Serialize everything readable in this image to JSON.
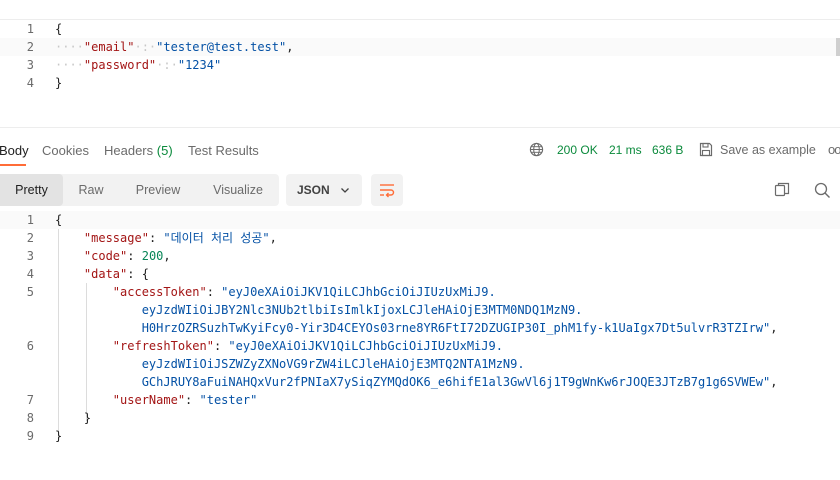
{
  "request_body": {
    "lines": [
      {
        "num": "1",
        "dots": "",
        "key": "",
        "sep": "",
        "value": "",
        "tail": "{"
      },
      {
        "num": "2",
        "dots": "····",
        "key": "\"email\"",
        "sep": "·:·",
        "value": "\"tester@test.test\"",
        "tail": ","
      },
      {
        "num": "3",
        "dots": "····",
        "key": "\"password\"",
        "sep": "·:·",
        "value": "\"1234\"",
        "tail": ""
      },
      {
        "num": "4",
        "dots": "",
        "key": "",
        "sep": "",
        "value": "",
        "tail": "}"
      }
    ]
  },
  "response_tabs": {
    "body": "Body",
    "cookies": "Cookies",
    "headers": "Headers",
    "headers_count": "(5)",
    "test_results": "Test Results"
  },
  "response_meta": {
    "globe_icon": "globe-icon",
    "status": "200 OK",
    "time": "21 ms",
    "size": "636 B",
    "save_icon": "save-icon",
    "save_label": "Save as example",
    "more": "oo"
  },
  "toolbar": {
    "views": [
      "Pretty",
      "Raw",
      "Preview",
      "Visualize"
    ],
    "active_view": "Pretty",
    "format": "JSON",
    "wrap_icon": "wrap-lines-icon",
    "copy_icon": "copy-icon",
    "search_icon": "search-icon"
  },
  "response_body": {
    "lines": [
      {
        "num": "1",
        "parts": [
          {
            "t": "{",
            "c": "punct"
          }
        ]
      },
      {
        "num": "2",
        "parts": [
          {
            "t": "    ",
            "c": "punct"
          },
          {
            "t": "\"message\"",
            "c": "key"
          },
          {
            "t": ": ",
            "c": "punct"
          },
          {
            "t": "\"데이터 처리 성공\"",
            "c": "str"
          },
          {
            "t": ",",
            "c": "punct"
          }
        ]
      },
      {
        "num": "3",
        "parts": [
          {
            "t": "    ",
            "c": "punct"
          },
          {
            "t": "\"code\"",
            "c": "key"
          },
          {
            "t": ": ",
            "c": "punct"
          },
          {
            "t": "200",
            "c": "num"
          },
          {
            "t": ",",
            "c": "punct"
          }
        ]
      },
      {
        "num": "4",
        "parts": [
          {
            "t": "    ",
            "c": "punct"
          },
          {
            "t": "\"data\"",
            "c": "key"
          },
          {
            "t": ": {",
            "c": "punct"
          }
        ]
      },
      {
        "num": "5",
        "parts": [
          {
            "t": "        ",
            "c": "punct"
          },
          {
            "t": "\"accessToken\"",
            "c": "key"
          },
          {
            "t": ": ",
            "c": "punct"
          },
          {
            "t": "\"eyJ0eXAiOiJKV1QiLCJhbGciOiJIUzUxMiJ9.",
            "c": "str"
          }
        ]
      },
      {
        "num": "",
        "parts": [
          {
            "t": "            ",
            "c": "punct"
          },
          {
            "t": "eyJzdWIiOiJBY2Nlc3NUb2tlbiIsImlkIjoxLCJleHAiOjE3MTM0NDQ1MzN9.",
            "c": "str"
          }
        ]
      },
      {
        "num": "",
        "parts": [
          {
            "t": "            ",
            "c": "punct"
          },
          {
            "t": "H0HrzOZRSuzhTwKyiFcy0-Yir3D4CEYOs03rne8YR6FtI72DZUGIP30I_phM1fy-k1UaIgx7Dt5ulvrR3TZIrw\"",
            "c": "str"
          },
          {
            "t": ",",
            "c": "punct"
          }
        ]
      },
      {
        "num": "6",
        "parts": [
          {
            "t": "        ",
            "c": "punct"
          },
          {
            "t": "\"refreshToken\"",
            "c": "key"
          },
          {
            "t": ": ",
            "c": "punct"
          },
          {
            "t": "\"eyJ0eXAiOiJKV1QiLCJhbGciOiJIUzUxMiJ9.",
            "c": "str"
          }
        ]
      },
      {
        "num": "",
        "parts": [
          {
            "t": "            ",
            "c": "punct"
          },
          {
            "t": "eyJzdWIiOiJSZWZyZXNoVG9rZW4iLCJleHAiOjE3MTQ2NTA1MzN9.",
            "c": "str"
          }
        ]
      },
      {
        "num": "",
        "parts": [
          {
            "t": "            ",
            "c": "punct"
          },
          {
            "t": "GChJRUY8aFuiNAHQxVur2fPNIaX7ySiqZYMQdOK6_e6hifE1al3GwVl6j1T9gWnKw6rJOQE3JTzB7g1g6SVWEw\"",
            "c": "str"
          },
          {
            "t": ",",
            "c": "punct"
          }
        ]
      },
      {
        "num": "7",
        "parts": [
          {
            "t": "        ",
            "c": "punct"
          },
          {
            "t": "\"userName\"",
            "c": "key"
          },
          {
            "t": ": ",
            "c": "punct"
          },
          {
            "t": "\"tester\"",
            "c": "str"
          }
        ]
      },
      {
        "num": "8",
        "parts": [
          {
            "t": "    ",
            "c": "punct"
          },
          {
            "t": "}",
            "c": "punct"
          }
        ]
      },
      {
        "num": "9",
        "parts": [
          {
            "t": "}",
            "c": "punct"
          }
        ]
      }
    ]
  }
}
